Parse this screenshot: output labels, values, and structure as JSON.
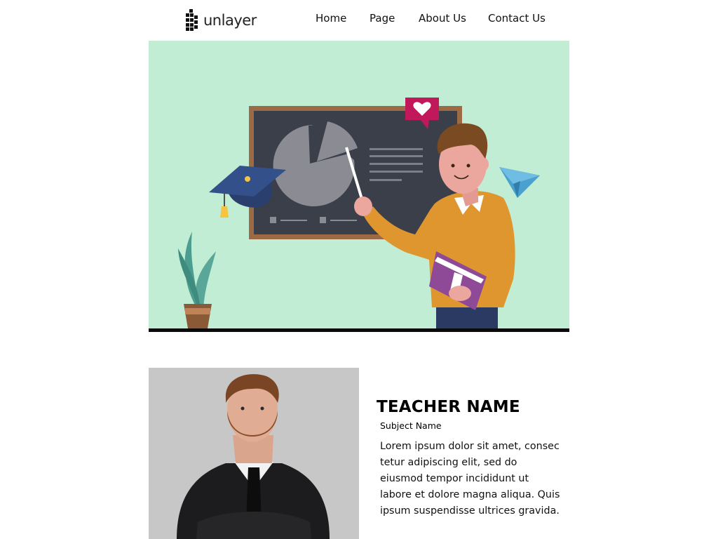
{
  "brand": {
    "name": "unlayer"
  },
  "nav": {
    "items": [
      {
        "label": "Home"
      },
      {
        "label": "Page"
      },
      {
        "label": "About Us"
      },
      {
        "label": "Contact Us"
      }
    ]
  },
  "hero": {
    "background": "#c0edd3",
    "icons": [
      "teacher-illustration",
      "chalkboard",
      "pie-chart",
      "graduation-cap",
      "heart-speech-bubble",
      "paper-plane",
      "potted-plant",
      "book"
    ]
  },
  "profile": {
    "teacher_name": "TEACHER NAME",
    "subject": "Subject Name",
    "bio": "Lorem ipsum dolor sit amet, consec tetur adipiscing elit, sed do eiusmod tempor incididunt ut labore et dolore magna aliqua. Quis ipsum suspendisse ultrices gravida."
  },
  "colors": {
    "accent_heart": "#c0185a",
    "sweater": "#e0962f",
    "book": "#8e4a96",
    "board": "#3a3f4a",
    "frame": "#9c6a44"
  }
}
